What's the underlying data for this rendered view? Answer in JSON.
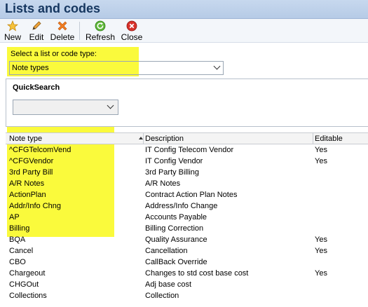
{
  "window": {
    "title": "Lists and codes"
  },
  "toolbar": {
    "new_label": "New",
    "edit_label": "Edit",
    "delete_label": "Delete",
    "refresh_label": "Refresh",
    "close_label": "Close"
  },
  "list_selector": {
    "label": "Select a list or code type:",
    "value": "Note types"
  },
  "quicksearch": {
    "title": "QuickSearch",
    "value": ""
  },
  "grid": {
    "columns": [
      "Note type",
      "Description",
      "Editable"
    ],
    "rows": [
      {
        "type": "^CFGTelcomVend",
        "desc": "IT Config Telecom Vendor",
        "editable": "Yes"
      },
      {
        "type": "^CFGVendor",
        "desc": "IT Config Vendor",
        "editable": "Yes"
      },
      {
        "type": "3rd Party Bill",
        "desc": "3rd Party Billing",
        "editable": ""
      },
      {
        "type": "A/R Notes",
        "desc": "A/R Notes",
        "editable": ""
      },
      {
        "type": "ActionPlan",
        "desc": "Contract Action Plan Notes",
        "editable": ""
      },
      {
        "type": "Addr/Info Chng",
        "desc": "Address/Info Change",
        "editable": ""
      },
      {
        "type": "AP",
        "desc": "Accounts Payable",
        "editable": ""
      },
      {
        "type": "Billing",
        "desc": "Billing Correction",
        "editable": ""
      },
      {
        "type": "BQA",
        "desc": "Quality Assurance",
        "editable": "Yes"
      },
      {
        "type": "Cancel",
        "desc": "Cancellation",
        "editable": "Yes"
      },
      {
        "type": "CBO",
        "desc": "CallBack Override",
        "editable": ""
      },
      {
        "type": "Chargeout",
        "desc": "Changes to std cost base cost",
        "editable": "Yes"
      },
      {
        "type": "CHGOut",
        "desc": "Adj base cost",
        "editable": ""
      },
      {
        "type": "Collections",
        "desc": "Collection",
        "editable": ""
      }
    ]
  },
  "colors": {
    "highlight": "#fafa3c",
    "titlebar": "#c0d3ec",
    "title_text": "#15365f"
  },
  "icons": [
    "star-icon",
    "pencil-icon",
    "delete-x-icon",
    "refresh-icon",
    "close-icon",
    "chevron-down-icon",
    "sort-ascending-icon"
  ]
}
